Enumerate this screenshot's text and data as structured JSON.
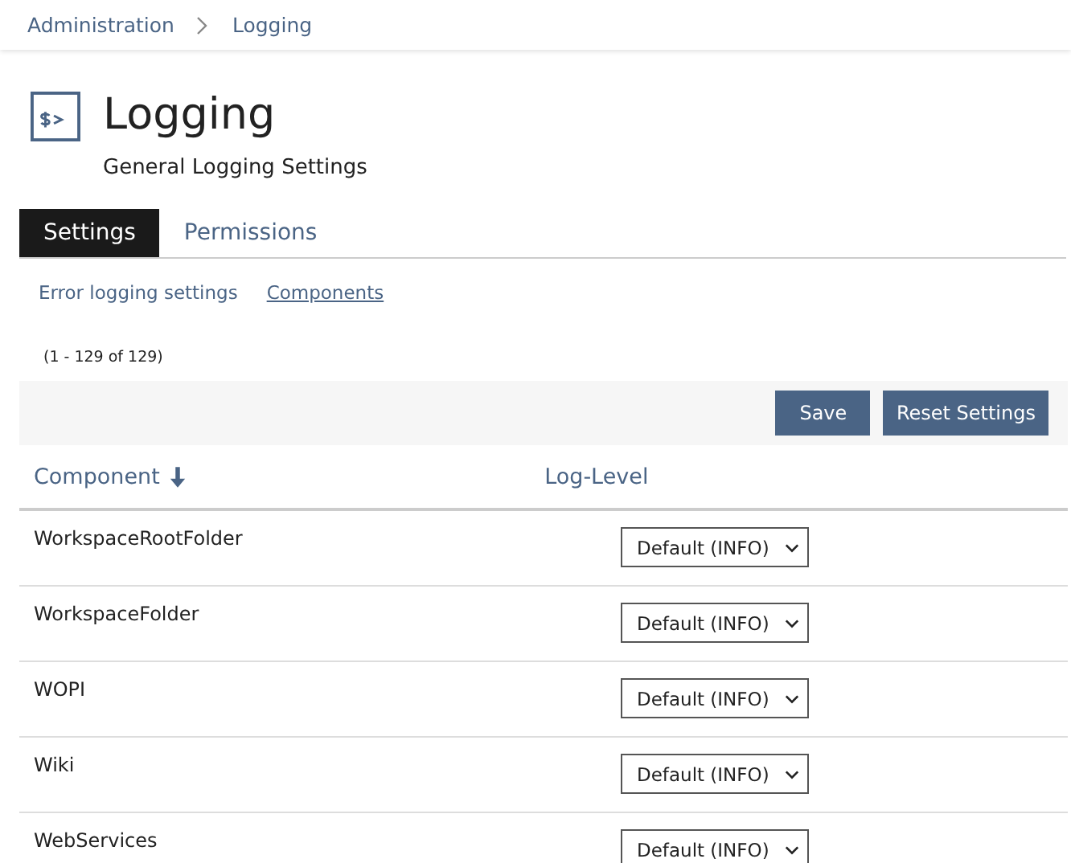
{
  "breadcrumb": [
    "Administration",
    "Logging"
  ],
  "header": {
    "title": "Logging",
    "subtitle": "General Logging Settings"
  },
  "tabs": [
    {
      "label": "Settings",
      "selected": true
    },
    {
      "label": "Permissions",
      "selected": false
    }
  ],
  "sub_links": [
    {
      "label": "Error logging settings",
      "selected": false
    },
    {
      "label": "Components",
      "selected": true
    }
  ],
  "count": "(1 - 129 of 129)",
  "buttons": [
    "Save",
    "Reset Settings"
  ],
  "table": {
    "columns": [
      {
        "label": "Component",
        "sorted": true
      },
      {
        "label": "Log-Level",
        "sorted": false
      }
    ],
    "rows": [
      {
        "component": "WorkspaceRootFolder",
        "level": "Default (INFO)"
      },
      {
        "component": "WorkspaceFolder",
        "level": "Default (INFO)"
      },
      {
        "component": "WOPI",
        "level": "Default (INFO)"
      },
      {
        "component": "Wiki",
        "level": "Default (INFO)"
      },
      {
        "component": "WebServices",
        "level": "Default (INFO)"
      }
    ]
  }
}
